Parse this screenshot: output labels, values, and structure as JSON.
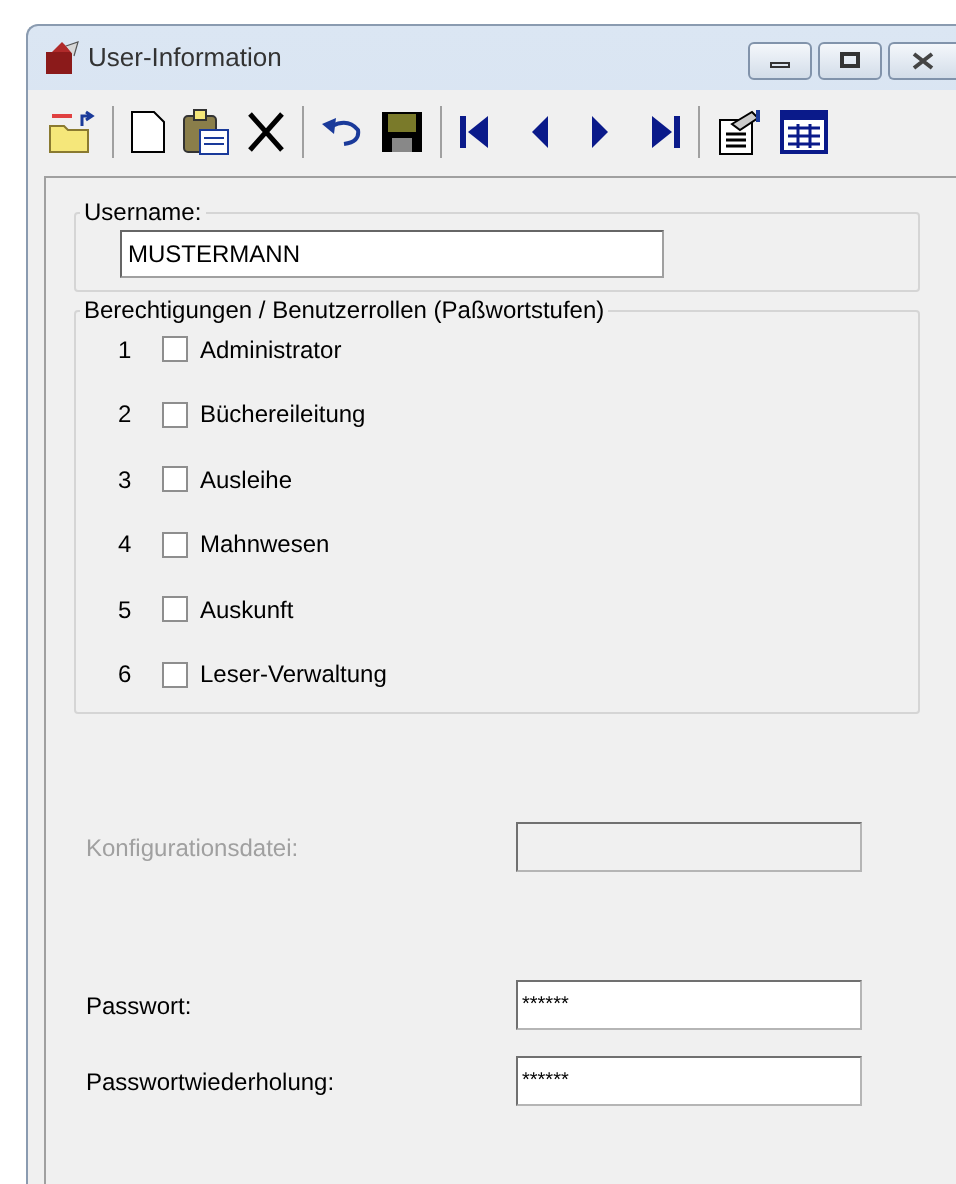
{
  "window": {
    "title": "User-Information"
  },
  "username": {
    "label": "Username:",
    "value": "MUSTERMANN"
  },
  "roles": {
    "title": "Berechtigungen / Benutzerrollen (Paßwortstufen)",
    "items": [
      {
        "number": "1",
        "label": "Administrator",
        "checked": false
      },
      {
        "number": "2",
        "label": "Büchereileitung",
        "checked": false
      },
      {
        "number": "3",
        "label": "Ausleihe",
        "checked": false
      },
      {
        "number": "4",
        "label": "Mahnwesen",
        "checked": false
      },
      {
        "number": "5",
        "label": "Auskunft",
        "checked": false
      },
      {
        "number": "6",
        "label": "Leser-Verwaltung",
        "checked": false
      }
    ]
  },
  "config": {
    "label": "Konfigurationsdatei:",
    "disabled": true
  },
  "password": {
    "label": "Passwort:",
    "value": "******",
    "disabled": false
  },
  "password_repeat": {
    "label": "Passwortwiederholung:",
    "value": "******",
    "disabled": false
  }
}
